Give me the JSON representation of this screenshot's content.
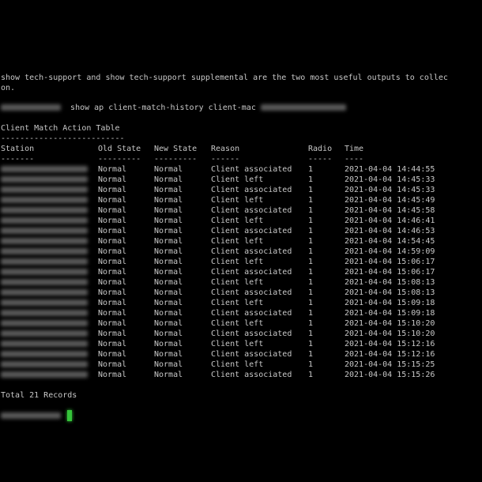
{
  "terminal": {
    "intro_line_1": "show tech-support and show tech-support supplemental are the two most useful outputs to collec",
    "intro_line_2": "on.",
    "prompt_command": "show ap client-match-history client-mac",
    "table_title": "Client Match Action Table",
    "table_title_underline": "--------------------------",
    "footer": "Total 21 Records",
    "cursor_color": "#35c43a"
  },
  "table": {
    "headers": {
      "station": "Station",
      "old_state": "Old State",
      "new_state": "New State",
      "reason": "Reason",
      "radio": "Radio",
      "time": "Time"
    },
    "underlines": {
      "station": "-------",
      "old_state": "---------",
      "new_state": "---------",
      "reason": "------",
      "radio": "-----",
      "time": "----"
    },
    "rows": [
      {
        "old": "Normal",
        "new": "Normal",
        "reason": "Client associated",
        "radio": "1",
        "time": "2021-04-04 14:44:55"
      },
      {
        "old": "Normal",
        "new": "Normal",
        "reason": "Client left",
        "radio": "1",
        "time": "2021-04-04 14:45:33"
      },
      {
        "old": "Normal",
        "new": "Normal",
        "reason": "Client associated",
        "radio": "1",
        "time": "2021-04-04 14:45:33"
      },
      {
        "old": "Normal",
        "new": "Normal",
        "reason": "Client left",
        "radio": "1",
        "time": "2021-04-04 14:45:49"
      },
      {
        "old": "Normal",
        "new": "Normal",
        "reason": "Client associated",
        "radio": "1",
        "time": "2021-04-04 14:45:58"
      },
      {
        "old": "Normal",
        "new": "Normal",
        "reason": "Client left",
        "radio": "1",
        "time": "2021-04-04 14:46:41"
      },
      {
        "old": "Normal",
        "new": "Normal",
        "reason": "Client associated",
        "radio": "1",
        "time": "2021-04-04 14:46:53"
      },
      {
        "old": "Normal",
        "new": "Normal",
        "reason": "Client left",
        "radio": "1",
        "time": "2021-04-04 14:54:45"
      },
      {
        "old": "Normal",
        "new": "Normal",
        "reason": "Client associated",
        "radio": "1",
        "time": "2021-04-04 14:59:09"
      },
      {
        "old": "Normal",
        "new": "Normal",
        "reason": "Client left",
        "radio": "1",
        "time": "2021-04-04 15:06:17"
      },
      {
        "old": "Normal",
        "new": "Normal",
        "reason": "Client associated",
        "radio": "1",
        "time": "2021-04-04 15:06:17"
      },
      {
        "old": "Normal",
        "new": "Normal",
        "reason": "Client left",
        "radio": "1",
        "time": "2021-04-04 15:08:13"
      },
      {
        "old": "Normal",
        "new": "Normal",
        "reason": "Client associated",
        "radio": "1",
        "time": "2021-04-04 15:08:13"
      },
      {
        "old": "Normal",
        "new": "Normal",
        "reason": "Client left",
        "radio": "1",
        "time": "2021-04-04 15:09:18"
      },
      {
        "old": "Normal",
        "new": "Normal",
        "reason": "Client associated",
        "radio": "1",
        "time": "2021-04-04 15:09:18"
      },
      {
        "old": "Normal",
        "new": "Normal",
        "reason": "Client left",
        "radio": "1",
        "time": "2021-04-04 15:10:20"
      },
      {
        "old": "Normal",
        "new": "Normal",
        "reason": "Client associated",
        "radio": "1",
        "time": "2021-04-04 15:10:20"
      },
      {
        "old": "Normal",
        "new": "Normal",
        "reason": "Client left",
        "radio": "1",
        "time": "2021-04-04 15:12:16"
      },
      {
        "old": "Normal",
        "new": "Normal",
        "reason": "Client associated",
        "radio": "1",
        "time": "2021-04-04 15:12:16"
      },
      {
        "old": "Normal",
        "new": "Normal",
        "reason": "Client left",
        "radio": "1",
        "time": "2021-04-04 15:15:25"
      },
      {
        "old": "Normal",
        "new": "Normal",
        "reason": "Client associated",
        "radio": "1",
        "time": "2021-04-04 15:15:26"
      }
    ]
  }
}
